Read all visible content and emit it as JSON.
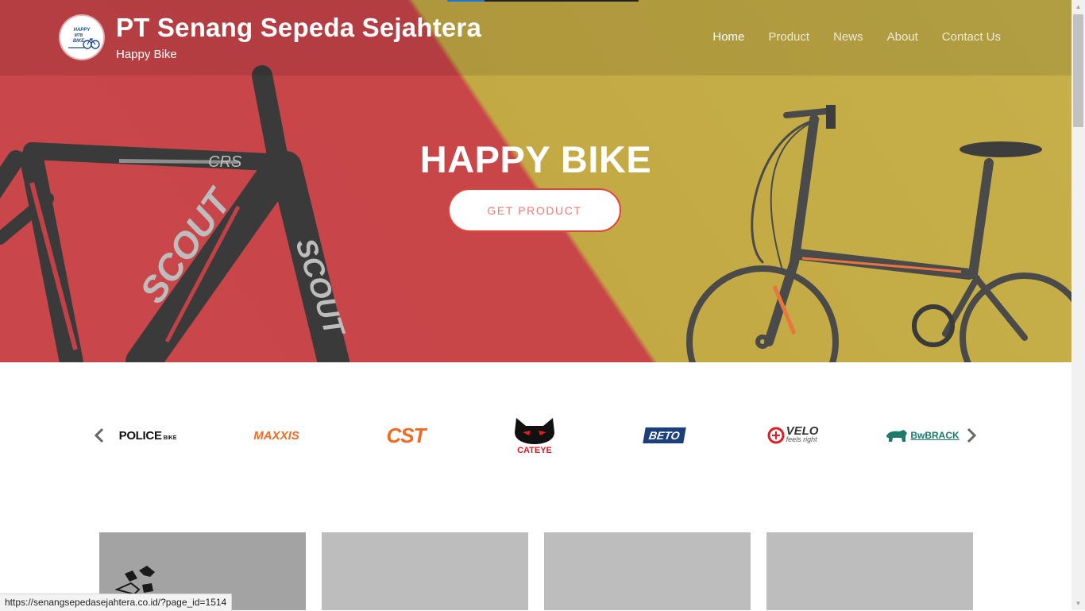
{
  "header": {
    "site_title": "PT Senang Sepeda Sejahtera",
    "tagline": "Happy Bike",
    "logo_text": [
      "HAPPY",
      "MTB",
      "BIKE"
    ]
  },
  "nav": {
    "items": [
      {
        "label": "Home",
        "active": true
      },
      {
        "label": "Product",
        "active": false
      },
      {
        "label": "News",
        "active": false
      },
      {
        "label": "About",
        "active": false
      },
      {
        "label": "Contact Us",
        "active": false
      }
    ]
  },
  "hero": {
    "title": "HAPPY BIKE",
    "button_label": "GET PRODUCT",
    "frame_text": [
      "SCOUT",
      "CRS"
    ]
  },
  "brands": {
    "items": [
      {
        "name": "POLICE",
        "suffix": "BIKE",
        "icon": "police-logo"
      },
      {
        "name": "MAXXIS",
        "icon": "maxxis-logo"
      },
      {
        "name": "CST",
        "icon": "cst-logo"
      },
      {
        "name": "CATEYE",
        "icon": "cateye-logo"
      },
      {
        "name": "BETO",
        "icon": "beto-logo"
      },
      {
        "name": "VELO",
        "sub": "feels right",
        "icon": "velo-logo"
      },
      {
        "name": "BwBRACK",
        "icon": "bwbrack-logo"
      }
    ]
  },
  "status_bar": {
    "url": "https://senangsepedasejahtera.co.id/?page_id=1514"
  },
  "colors": {
    "hero_red": "#c84548",
    "hero_yellow": "#c6b04a",
    "button_border": "#e0443a",
    "button_text": "#ee7b73"
  }
}
